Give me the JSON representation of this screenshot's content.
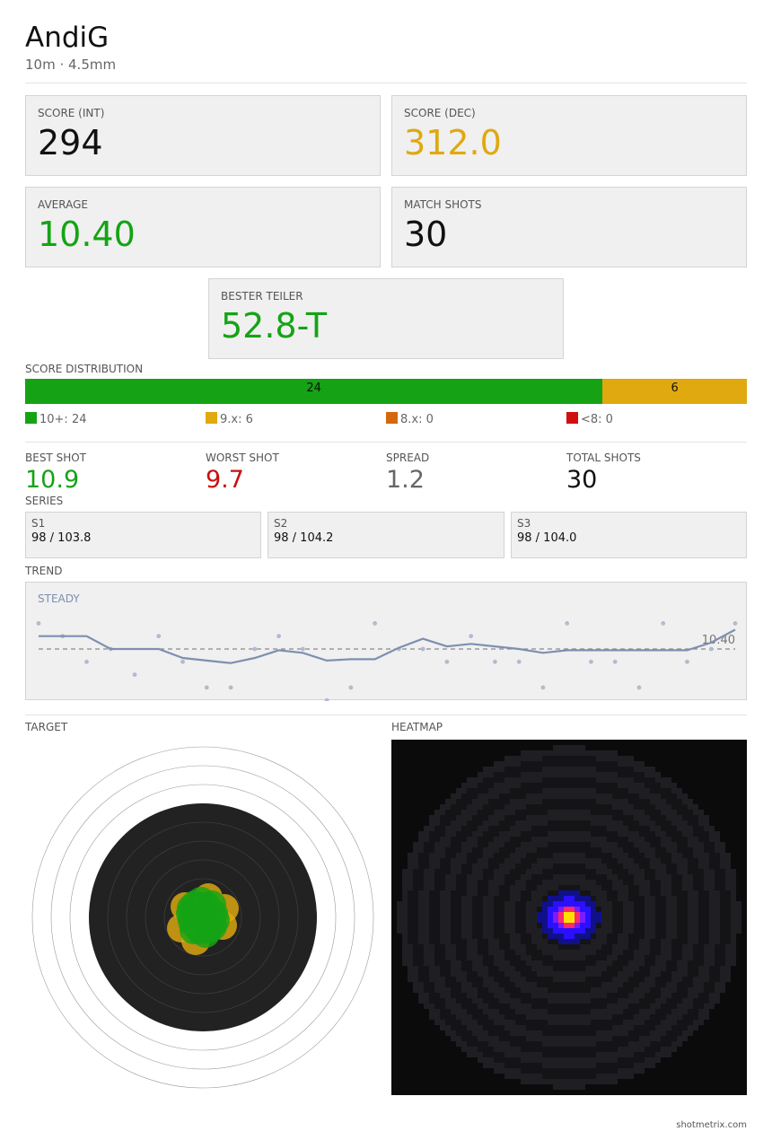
{
  "header": {
    "name": "AndiG",
    "subtitle": "10m  ·  4.5mm"
  },
  "cards": {
    "score_int": {
      "label": "SCORE (INT)",
      "value": "294"
    },
    "score_dec": {
      "label": "SCORE (DEC)",
      "value": "312.0"
    },
    "average": {
      "label": "AVERAGE",
      "value": "10.40"
    },
    "match_shots": {
      "label": "MATCH SHOTS",
      "value": "30"
    },
    "bester_teiler": {
      "label": "BESTER TEILER",
      "value": "52.8-T"
    }
  },
  "distribution": {
    "label": "SCORE DISTRIBUTION",
    "segments": [
      {
        "key": "10+",
        "count": 24,
        "color": "#15a315"
      },
      {
        "key": "9.x",
        "count": 6,
        "color": "#dfa90f"
      },
      {
        "key": "8.x",
        "count": 0,
        "color": "#d4680f"
      },
      {
        "key": "<8",
        "count": 0,
        "color": "#d10f0f"
      }
    ],
    "legend": [
      "10+: 24",
      "9.x: 6",
      "8.x: 0",
      "<8: 0"
    ]
  },
  "stats": {
    "best": {
      "label": "BEST SHOT",
      "value": "10.9"
    },
    "worst": {
      "label": "WORST SHOT",
      "value": "9.7"
    },
    "spread": {
      "label": "SPREAD",
      "value": "1.2"
    },
    "total": {
      "label": "TOTAL SHOTS",
      "value": "30"
    }
  },
  "series": {
    "label": "SERIES",
    "items": [
      {
        "name": "S1",
        "value": "98 / 103.8"
      },
      {
        "name": "S2",
        "value": "98 / 104.2"
      },
      {
        "name": "S3",
        "value": "98 / 104.0"
      }
    ]
  },
  "trend": {
    "label": "TREND",
    "status": "STEADY",
    "average_label": "10.40",
    "average": 10.4,
    "shots": [
      10.6,
      10.5,
      10.3,
      10.4,
      10.2,
      10.5,
      10.3,
      10.1,
      10.1,
      10.4,
      10.5,
      10.4,
      10.0,
      10.1,
      10.6,
      10.4,
      10.4,
      10.3,
      10.5,
      10.3,
      10.3,
      10.1,
      10.6,
      10.3,
      10.3,
      10.1,
      10.6,
      10.3,
      10.4,
      10.6
    ],
    "trend_line": [
      10.5,
      10.5,
      10.5,
      10.4,
      10.4,
      10.4,
      10.33,
      10.31,
      10.29,
      10.33,
      10.39,
      10.37,
      10.31,
      10.32,
      10.32,
      10.41,
      10.48,
      10.42,
      10.44,
      10.42,
      10.4,
      10.37,
      10.39,
      10.39,
      10.39,
      10.39,
      10.39,
      10.39,
      10.45,
      10.55
    ],
    "color": "#7f8fb0"
  },
  "target": {
    "label": "TARGET",
    "shot_colors": {
      "ten": "#15a315",
      "nine": "#dfa90f"
    }
  },
  "heatmap": {
    "label": "HEATMAP"
  },
  "footer": {
    "text": "shotmetrix.com"
  }
}
